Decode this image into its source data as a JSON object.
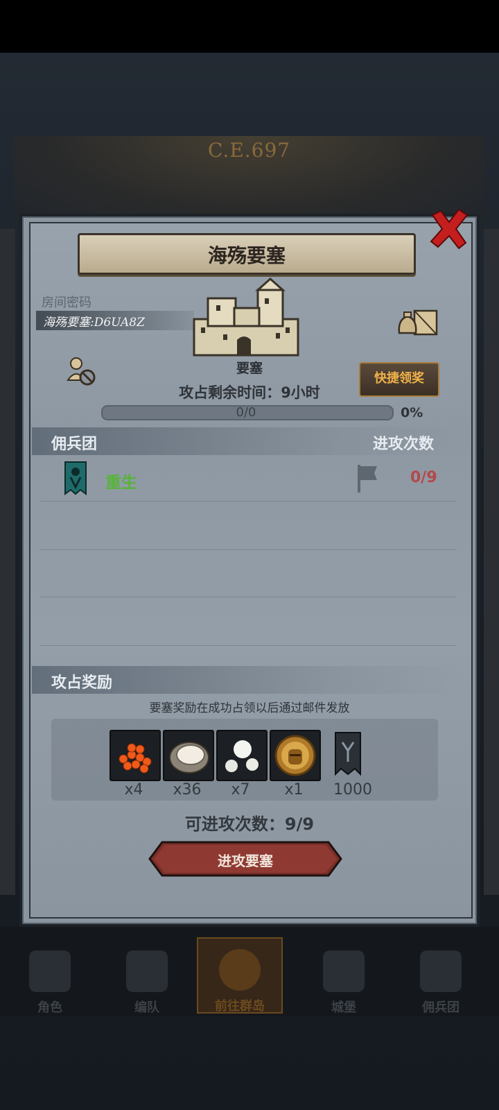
{
  "background": {
    "era_label": "C.E.697"
  },
  "dialog": {
    "title": "海殇要塞",
    "room_password_label": "房间密码",
    "room_password_value": "海殇要塞:D6UA8Z",
    "fortress_type": "要塞",
    "remaining_time_label": "攻占剩余时间：",
    "remaining_time_value": "9小时",
    "progress_text": "0/0",
    "progress_percent_text": "0%",
    "progress_fraction": 0,
    "quick_claim_label": "快捷领奖",
    "mercenary_section_label": "佣兵团",
    "attack_count_header": "进攻次数",
    "guilds": [
      {
        "name": "重生",
        "attacks": "0/9"
      }
    ],
    "reward_section_label": "攻占奖励",
    "reward_note": "要塞奖励在成功占领以后通过邮件发放",
    "rewards": [
      {
        "icon": "salmon-roe-icon",
        "count": "x4"
      },
      {
        "icon": "oyster-icon",
        "count": "x36"
      },
      {
        "icon": "pearl-icon",
        "count": "x7"
      },
      {
        "icon": "knight-medal-icon",
        "count": "x1"
      },
      {
        "icon": "guild-banner-icon",
        "count": "1000"
      }
    ],
    "remaining_attacks_label": "可进攻次数：",
    "remaining_attacks_value": "9/9",
    "attack_button_label": "进攻要塞"
  },
  "bottom_nav": [
    {
      "label": "角色",
      "icon": "character-icon"
    },
    {
      "label": "编队",
      "icon": "formation-icon"
    },
    {
      "label": "前往群岛",
      "icon": "islands-icon",
      "active": true
    },
    {
      "label": "城堡",
      "icon": "castle-icon"
    },
    {
      "label": "佣兵团",
      "icon": "mercenary-icon"
    }
  ],
  "colors": {
    "panel": "#98a2ac",
    "guild_name": "#57b43a",
    "attack_count": "#b5484a",
    "quick_claim_text": "#f0b24a",
    "attack_button": "#7a2e28"
  }
}
